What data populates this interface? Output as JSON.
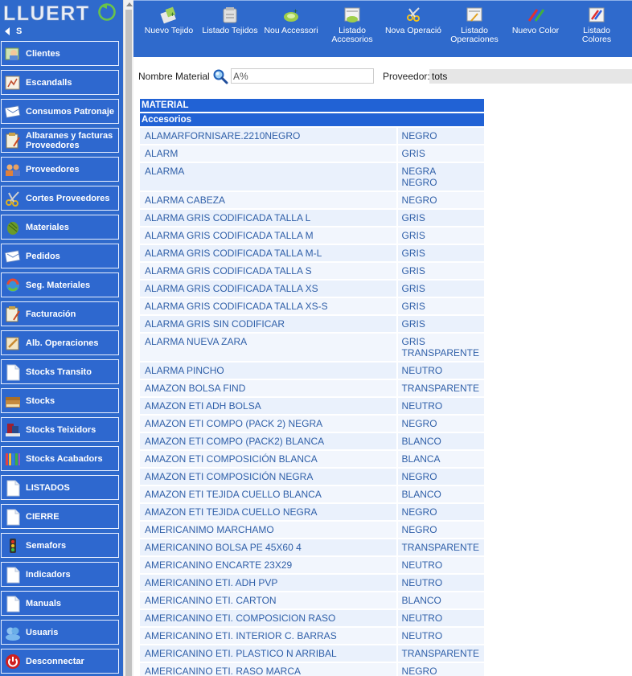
{
  "sidebar": {
    "logo_text": "LLUERT",
    "collapse_label": "S",
    "items": [
      {
        "label": "Clientes",
        "icon": "clients-icon"
      },
      {
        "label": "Escandalls",
        "icon": "escandalls-icon"
      },
      {
        "label": "Consumos Patronaje",
        "icon": "consumos-icon"
      },
      {
        "label": "Albaranes y facturas Proveedores",
        "icon": "albaranes-icon"
      },
      {
        "label": "Proveedores",
        "icon": "suppliers-icon"
      },
      {
        "label": "Cortes Proveedores",
        "icon": "scissors-icon"
      },
      {
        "label": "Materiales",
        "icon": "materials-icon"
      },
      {
        "label": "Pedidos",
        "icon": "orders-icon"
      },
      {
        "label": "Seg. Materiales",
        "icon": "tracking-icon"
      },
      {
        "label": "Facturación",
        "icon": "invoice-icon"
      },
      {
        "label": "Alb. Operaciones",
        "icon": "operations-icon"
      },
      {
        "label": "Stocks Transito",
        "icon": "document-icon"
      },
      {
        "label": "Stocks",
        "icon": "stocks-icon"
      },
      {
        "label": "Stocks Teixidors",
        "icon": "fabric-icon"
      },
      {
        "label": "Stocks Acabadors",
        "icon": "finishers-icon"
      },
      {
        "label": "LISTADOS",
        "icon": "document-icon"
      },
      {
        "label": "CIERRE",
        "icon": "document-icon"
      },
      {
        "label": "Semafors",
        "icon": "traffic-light-icon"
      },
      {
        "label": "Indicadors",
        "icon": "document-icon"
      },
      {
        "label": "Manuals",
        "icon": "document-icon"
      },
      {
        "label": "Usuaris",
        "icon": "users-icon"
      },
      {
        "label": "Desconnectar",
        "icon": "power-icon"
      }
    ]
  },
  "toolbar": {
    "items": [
      {
        "label": "Nuevo Tejido",
        "icon": "new-fabric-icon"
      },
      {
        "label": "Listado Tejidos",
        "icon": "fabric-list-icon"
      },
      {
        "label": "Nou Accessori",
        "icon": "new-accessory-icon"
      },
      {
        "label": "Listado Accesorios",
        "icon": "accessory-list-icon"
      },
      {
        "label": "Nova Operació",
        "icon": "new-operation-icon"
      },
      {
        "label": "Listado Operaciones",
        "icon": "operations-list-icon"
      },
      {
        "label": "Nuevo Color",
        "icon": "new-color-icon"
      },
      {
        "label": "Listado Colores",
        "icon": "color-list-icon"
      }
    ]
  },
  "filters": {
    "material_label": "Nombre Material",
    "material_value": "A%",
    "proveedor_label": "Proveedor:",
    "proveedor_value": "tots"
  },
  "table": {
    "header": "MATERIAL",
    "section": "Accesorios",
    "rows": [
      {
        "name": "ALAMARFORNISARE.2210NEGRO",
        "color": "NEGRO"
      },
      {
        "name": "ALARM",
        "color": "GRIS"
      },
      {
        "name": "ALARMA",
        "color": "NEGRA\nNEGRO"
      },
      {
        "name": "ALARMA CABEZA",
        "color": "NEGRO"
      },
      {
        "name": "ALARMA GRIS CODIFICADA TALLA L",
        "color": "GRIS"
      },
      {
        "name": "ALARMA GRIS CODIFICADA TALLA M",
        "color": "GRIS"
      },
      {
        "name": "ALARMA GRIS CODIFICADA TALLA M-L",
        "color": "GRIS"
      },
      {
        "name": "ALARMA GRIS CODIFICADA TALLA S",
        "color": "GRIS"
      },
      {
        "name": "ALARMA GRIS CODIFICADA TALLA XS",
        "color": "GRIS"
      },
      {
        "name": "ALARMA GRIS CODIFICADA TALLA XS-S",
        "color": "GRIS"
      },
      {
        "name": "ALARMA GRIS SIN CODIFICAR",
        "color": "GRIS"
      },
      {
        "name": "ALARMA NUEVA ZARA",
        "color": "GRIS\nTRANSPARENTE"
      },
      {
        "name": "ALARMA PINCHO",
        "color": "NEUTRO"
      },
      {
        "name": "AMAZON BOLSA FIND",
        "color": "TRANSPARENTE"
      },
      {
        "name": "AMAZON ETI ADH BOLSA",
        "color": "NEUTRO"
      },
      {
        "name": "AMAZON ETI COMPO (PACK 2) NEGRA",
        "color": "NEGRO"
      },
      {
        "name": "AMAZON ETI COMPO (PACK2) BLANCA",
        "color": "BLANCO"
      },
      {
        "name": "AMAZON ETI COMPOSICIÓN BLANCA",
        "color": "BLANCA"
      },
      {
        "name": "AMAZON ETI COMPOSICIÓN NEGRA",
        "color": "NEGRO"
      },
      {
        "name": "AMAZON ETI TEJIDA CUELLO BLANCA",
        "color": "BLANCO"
      },
      {
        "name": "AMAZON ETI TEJIDA CUELLO NEGRA",
        "color": "NEGRO"
      },
      {
        "name": "AMERICANIMO MARCHAMO",
        "color": "NEGRO"
      },
      {
        "name": "AMERICANINO BOLSA PE 45X60 4",
        "color": "TRANSPARENTE"
      },
      {
        "name": "AMERICANINO ENCARTE 23X29",
        "color": "NEUTRO"
      },
      {
        "name": "AMERICANINO ETI. ADH PVP",
        "color": "NEUTRO"
      },
      {
        "name": "AMERICANINO ETI. CARTON",
        "color": "BLANCO"
      },
      {
        "name": "AMERICANINO ETI. COMPOSICION RASO",
        "color": "NEUTRO"
      },
      {
        "name": "AMERICANINO ETI. INTERIOR C. BARRAS",
        "color": "NEUTRO"
      },
      {
        "name": "AMERICANINO ETI. PLASTICO N ARRIBAL",
        "color": "TRANSPARENTE"
      },
      {
        "name": "AMERICANINO ETI. RASO MARCA",
        "color": "NEGRO"
      }
    ]
  }
}
